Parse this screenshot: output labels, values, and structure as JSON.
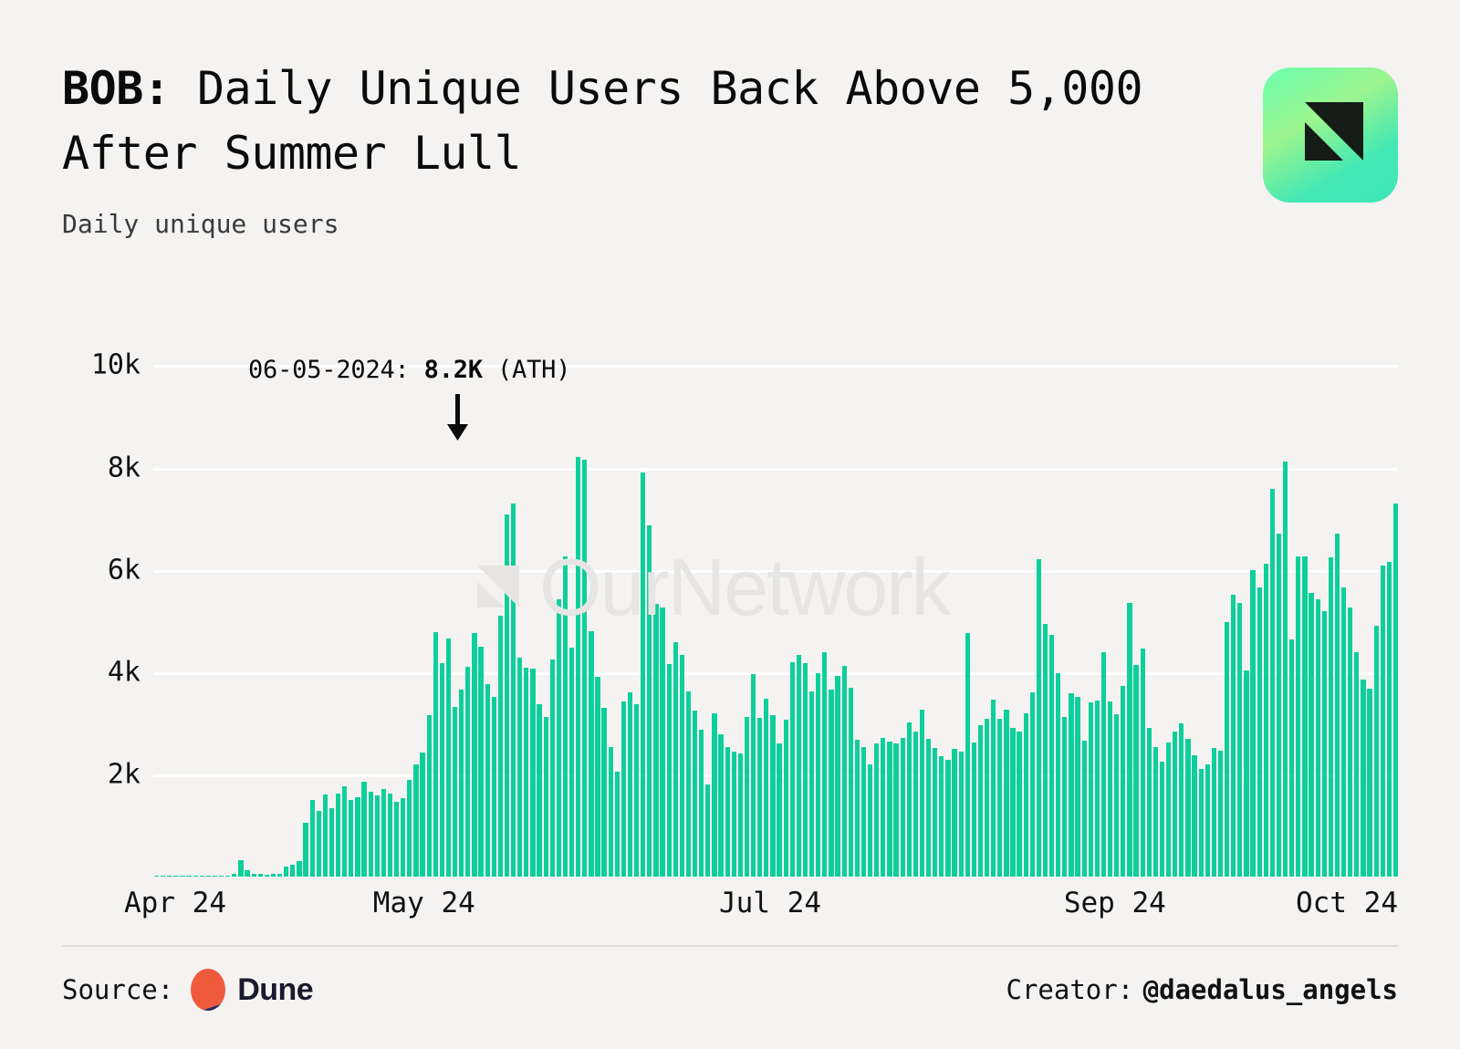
{
  "header": {
    "title_prefix": "BOB:",
    "title_rest": " Daily Unique Users Back Above 5,000 After Summer Lull",
    "subtitle": "Daily unique users",
    "logo_name": "ournetwork-logo"
  },
  "annotation": {
    "date": "06-05-2024:",
    "value": "8.2K",
    "tag": "(ATH)",
    "arrow_name": "annotation-arrow-down"
  },
  "watermark": {
    "text": "OurNetwork"
  },
  "footer": {
    "source_label": "Source:",
    "source_name": "Dune",
    "creator_label": "Creator:",
    "creator_handle": "@daedalus_angels"
  },
  "colors": {
    "background": "#f4f3f2",
    "bar": "#0ecf9b",
    "gridline": "#ffffff",
    "text": "#0b0b0b",
    "watermark": "#e6e5e4",
    "divider": "#dedddc",
    "dune_orange": "#f05a3c",
    "dune_navy": "#2b2b63",
    "logo_gradient_from": "#6bffb0",
    "logo_gradient_to": "#3fe6b8"
  },
  "chart_data": {
    "type": "bar",
    "title": "BOB: Daily Unique Users Back Above 5,000 After Summer Lull",
    "subtitle": "Daily unique users",
    "xlabel": "",
    "ylabel": "Daily unique users",
    "ylim": [
      0,
      10400
    ],
    "yticks": [
      2000,
      4000,
      6000,
      8000,
      10000
    ],
    "ytick_labels": [
      "2k",
      "4k",
      "6k",
      "8k",
      "10k"
    ],
    "grid": true,
    "legend": "none",
    "xtick_labels": [
      "Apr 24",
      "May 24",
      "Jul 24",
      "Sep 24",
      "Oct 24"
    ],
    "xtick_positions": [
      0,
      0.222,
      0.5,
      0.777,
      1.0
    ],
    "x_start": "2024-04-01",
    "x_end": "2024-10-01",
    "annotations": [
      {
        "date": "06-05-2024",
        "value": 8200,
        "label": "06-05-2024: 8.2K (ATH)"
      }
    ],
    "series": [
      {
        "name": "Daily unique users",
        "color": "#0ecf9b",
        "values": [
          10,
          8,
          12,
          9,
          14,
          11,
          16,
          13,
          18,
          15,
          22,
          19,
          60,
          320,
          120,
          60,
          45,
          40,
          55,
          50,
          200,
          240,
          300,
          1060,
          1500,
          1280,
          1600,
          1340,
          1620,
          1760,
          1500,
          1560,
          1860,
          1660,
          1580,
          1720,
          1620,
          1460,
          1540,
          1900,
          2200,
          2420,
          3150,
          4780,
          4180,
          4660,
          3320,
          3660,
          4100,
          4760,
          4500,
          3760,
          3520,
          5100,
          7080,
          7300,
          4280,
          4080,
          4060,
          3380,
          3120,
          4250,
          5420,
          6260,
          4480,
          8200,
          8160,
          4800,
          3900,
          3300,
          2540,
          2060,
          3420,
          3600,
          3380,
          7900,
          6860,
          5340,
          5260,
          4160,
          4580,
          4340,
          3620,
          3240,
          2880,
          1800,
          3200,
          2780,
          2540,
          2450,
          2400,
          3120,
          3960,
          3100,
          3480,
          3160,
          2600,
          3060,
          4200,
          4340,
          4180,
          3620,
          3980,
          4380,
          3660,
          3920,
          4120,
          3700,
          2680,
          2540,
          2200,
          2600,
          2720,
          2640,
          2600,
          2720,
          3020,
          2840,
          3260,
          2700,
          2520,
          2350,
          2280,
          2500,
          2440,
          4760,
          2620,
          2960,
          3080,
          3460,
          3080,
          3260,
          2900,
          2840,
          3200,
          3600,
          6200,
          4940,
          4720,
          3980,
          3120,
          3580,
          3520,
          2660,
          3400,
          3440,
          4380,
          3420,
          3180,
          3720,
          5350,
          4140,
          4460,
          2900,
          2540,
          2240,
          2620,
          2840,
          3000,
          2700,
          2380,
          2100,
          2200,
          2520,
          2460,
          4980,
          5520,
          5360,
          4040,
          6000,
          5660,
          6120,
          7580,
          6700,
          8120,
          4640,
          6260,
          6260,
          5540,
          5420,
          5200,
          6240,
          6700,
          5660,
          5260,
          4380,
          3860,
          3680,
          4900,
          6080,
          6160,
          7300
        ]
      }
    ]
  }
}
